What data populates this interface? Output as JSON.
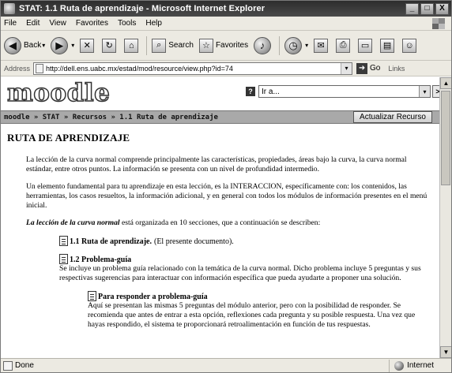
{
  "window": {
    "title": "STAT: 1.1 Ruta de aprendizaje - Microsoft Internet Explorer",
    "controls": [
      "_",
      "□",
      "X"
    ]
  },
  "menubar": {
    "items": [
      "File",
      "Edit",
      "View",
      "Favorites",
      "Tools",
      "Help"
    ]
  },
  "toolbar": {
    "back": "Back",
    "search": "Search",
    "favorites": "Favorites"
  },
  "address": {
    "label": "Address",
    "url": "http://dell.ens.uabc.mx/estad/mod/resource/view.php?id=74",
    "go": "Go",
    "links": "Links"
  },
  "moodle": {
    "logo": "moodle",
    "jump_value": "Ir a...",
    "breadcrumb": "moodle » STAT » Recursos » 1.1 Ruta de aprendizaje",
    "update_button": "Actualizar Recurso"
  },
  "content": {
    "heading": "RUTA DE APRENDIZAJE",
    "p1": "La lección de la curva normal comprende principalmente las características, propiedades, áreas bajo la curva, la curva normal estándar, entre otros puntos. La información se presenta con un nivel de profundidad intermedio.",
    "p2": "Un elemento fundamental para tu aprendizaje en esta lección, es la INTERACCION, específicamente con: los contenidos, las herramientas, los casos resueltos, la información adicional, y en general con todos los módulos de información presentes en el menú inicial.",
    "p3_em": "La lección de la curva normal",
    "p3_rest": " está organizada en 10 secciones, que a continuación se describen:",
    "item1_title": "1.1 Ruta de aprendizaje.",
    "item1_rest": "(El presente documento).",
    "item2_title": "1.2 Problema-guía",
    "item2_desc": "Se incluye un problema guía relacionado con la temática de la curva normal. Dicho problema incluye 5 preguntas y sus respectivas sugerencias para interactuar con información específica que pueda ayudarte a proponer una solución.",
    "item3_title": "Para responder a problema-guía",
    "item3_desc": "Aquí se presentan las mismas 5 preguntas del módulo anterior, pero con la posibilidad de responder. Se recomienda que antes de entrar a esta opción, reflexiones cada pregunta y su posible respuesta. Una vez que hayas respondido, el sistema te proporcionará retroalimentación en función de tus respuestas."
  },
  "status": {
    "left": "Done",
    "zone": "Internet"
  }
}
